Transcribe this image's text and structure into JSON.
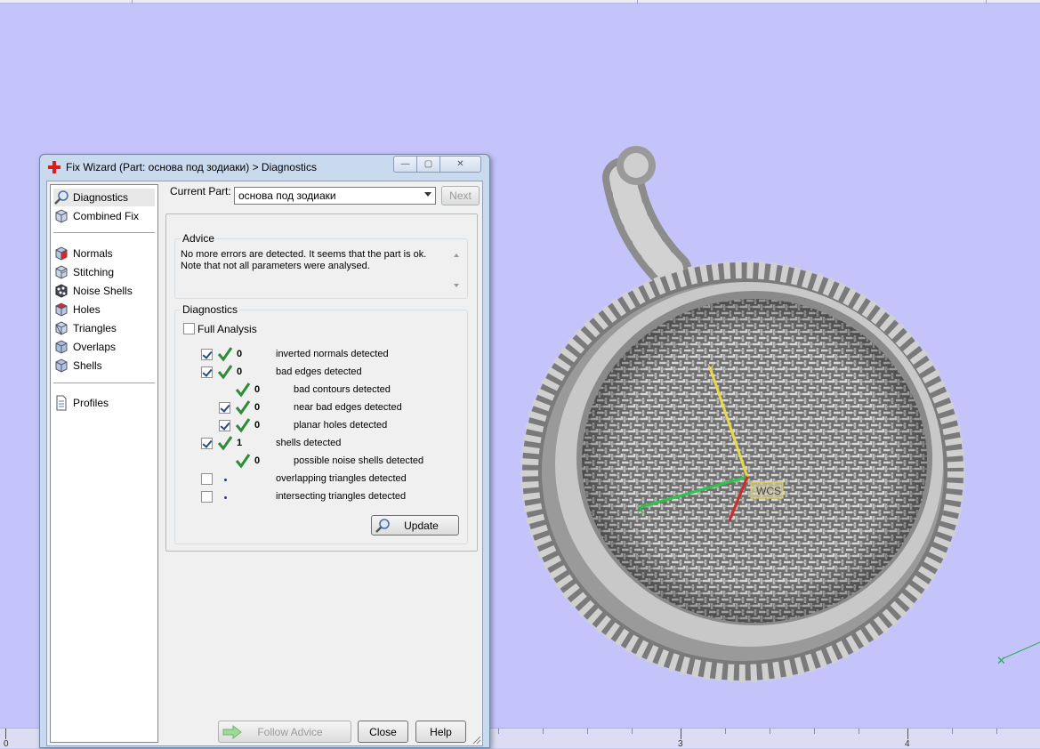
{
  "dialog": {
    "title": "Fix Wizard (Part: основа под зодиаки) > Diagnostics",
    "min_glyph": "—",
    "max_glyph": "▢",
    "close_glyph": "✕"
  },
  "nav": {
    "items": [
      {
        "label": "Diagnostics",
        "icon": "magnifier-icon",
        "selected": true
      },
      {
        "label": "Combined Fix",
        "icon": "cube-icon"
      },
      {
        "label": "Normals",
        "icon": "normals-cube-icon"
      },
      {
        "label": "Stitching",
        "icon": "stitching-cube-icon"
      },
      {
        "label": "Noise Shells",
        "icon": "noise-shells-icon"
      },
      {
        "label": "Holes",
        "icon": "holes-cube-icon"
      },
      {
        "label": "Triangles",
        "icon": "triangles-cube-icon"
      },
      {
        "label": "Overlaps",
        "icon": "overlaps-cube-icon"
      },
      {
        "label": "Shells",
        "icon": "shells-cube-icon"
      },
      {
        "label": "Profiles",
        "icon": "document-icon"
      }
    ]
  },
  "current_part": {
    "label": "Current Part:",
    "value": "основа под зодиаки",
    "next_label": "Next"
  },
  "advice": {
    "title": "Advice",
    "line1": "No more errors are detected. It seems that the part is ok.",
    "line2": "Note that not all parameters were analysed."
  },
  "diagnostics": {
    "title": "Diagnostics",
    "full_analysis_label": "Full Analysis",
    "full_analysis_checked": false,
    "rows": [
      {
        "text": "inverted normals detected",
        "count": "0",
        "checkbox": true,
        "checked": true,
        "status": "ok"
      },
      {
        "text": "bad edges detected",
        "count": "0",
        "checkbox": true,
        "checked": true,
        "status": "ok"
      },
      {
        "text": "bad contours detected",
        "count": "0",
        "checkbox": false,
        "status": "ok"
      },
      {
        "text": "near bad edges detected",
        "count": "0",
        "checkbox": true,
        "checked": true,
        "status": "ok"
      },
      {
        "text": "planar holes detected",
        "count": "0",
        "checkbox": true,
        "checked": true,
        "status": "ok"
      },
      {
        "text": "shells detected",
        "count": "1",
        "checkbox": true,
        "checked": true,
        "status": "ok"
      },
      {
        "text": "possible noise shells detected",
        "count": "0",
        "checkbox": false,
        "status": "ok"
      },
      {
        "text": "overlapping triangles detected",
        "count": "",
        "checkbox": true,
        "checked": false,
        "status": "not-analysed"
      },
      {
        "text": "intersecting triangles detected",
        "count": "",
        "checkbox": true,
        "checked": false,
        "status": "not-analysed"
      }
    ],
    "update_label": "Update"
  },
  "footer": {
    "follow_advice_label": "Follow Advice",
    "close_label": "Close",
    "help_label": "Help"
  },
  "viewport": {
    "wcs_label": "WCS",
    "ruler_labels": [
      "0",
      "3",
      "4"
    ],
    "axis_mark": "✕"
  },
  "colors": {
    "viewport_bg": "#c4c4fb",
    "check_green": "#2e8b3a",
    "axis_y": "#e8d84a",
    "axis_x": "#2ec44a",
    "axis_z": "#d02a2a"
  }
}
